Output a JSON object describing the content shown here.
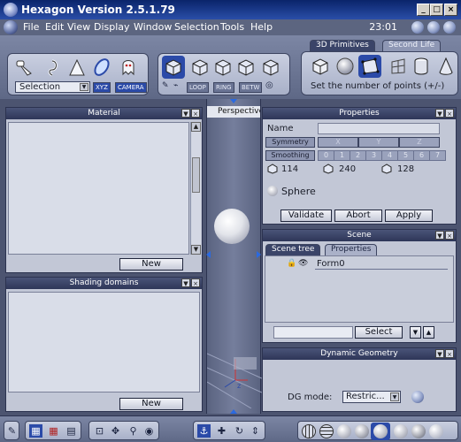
{
  "window": {
    "title": "Hexagon Version 2.5.1.79",
    "min_glyph": "_",
    "max_glyph": "□",
    "close_glyph": "×"
  },
  "menu": {
    "items": [
      "File",
      "Edit",
      "View",
      "Display",
      "Window",
      "Selection",
      "Tools",
      "Help"
    ],
    "clock": "23:01"
  },
  "toolbar": {
    "selection_dropdown": "Selection",
    "xyz_label": "XYZ",
    "camera_label": "CAMERA",
    "modes": [
      "LOOP",
      "RING",
      "BETW"
    ],
    "tabs": [
      "3D Primitives",
      "Second Life"
    ],
    "status_hint": "Set the number of points (+/-)"
  },
  "material_panel": {
    "title": "Material",
    "new_button": "New"
  },
  "shading_panel": {
    "title": "Shading domains",
    "new_button": "New"
  },
  "viewport": {
    "title": "Perspective"
  },
  "properties_panel": {
    "title": "Properties",
    "name_label": "Name",
    "name_value": "",
    "symmetry_label": "Symmetry",
    "symmetry_axes": [
      "X",
      "Y",
      "Z"
    ],
    "smoothing_label": "Smoothing",
    "smoothing_levels": [
      "0",
      "1",
      "2",
      "3",
      "4",
      "5",
      "6",
      "7"
    ],
    "counts": [
      "114",
      "240",
      "128"
    ],
    "object_type": "Sphere",
    "validate_button": "Validate",
    "abort_button": "Abort",
    "apply_button": "Apply"
  },
  "scene_panel": {
    "title": "Scene",
    "tabs": [
      "Scene tree",
      "Properties"
    ],
    "tree_items": [
      "Form0"
    ],
    "select_input_value": "",
    "select_button": "Select"
  },
  "dg_panel": {
    "title": "Dynamic Geometry",
    "mode_label": "DG mode:",
    "mode_value": "Restric..."
  },
  "colors": {
    "titlebar": "#0a246a",
    "panel_header": "#2e3658",
    "panel_body": "#c2c7d6",
    "accent": "#2b4aa8"
  }
}
